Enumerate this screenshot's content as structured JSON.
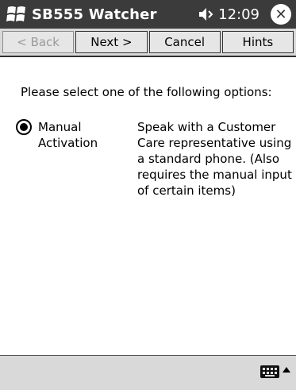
{
  "titlebar": {
    "title": "SB555 Watcher",
    "time": "12:09",
    "icons": [
      "windows-flag-icon",
      "speaker-icon",
      "close-icon"
    ],
    "close_glyph": "✕"
  },
  "wizard": {
    "back": "< Back",
    "next": "Next >",
    "cancel": "Cancel",
    "hints": "Hints"
  },
  "content": {
    "prompt": "Please select one of the following options:",
    "option": {
      "label": "Manual Activation",
      "description": "Speak with a Customer Care representative using a standard phone. (Also requires the manual input of certain items)",
      "selected": true
    }
  },
  "bottombar": {
    "icons": [
      "keyboard-icon",
      "up-arrow-icon"
    ]
  },
  "colors": {
    "titlebar": "#3b3b3b",
    "toolbar": "#d9d9d9"
  }
}
